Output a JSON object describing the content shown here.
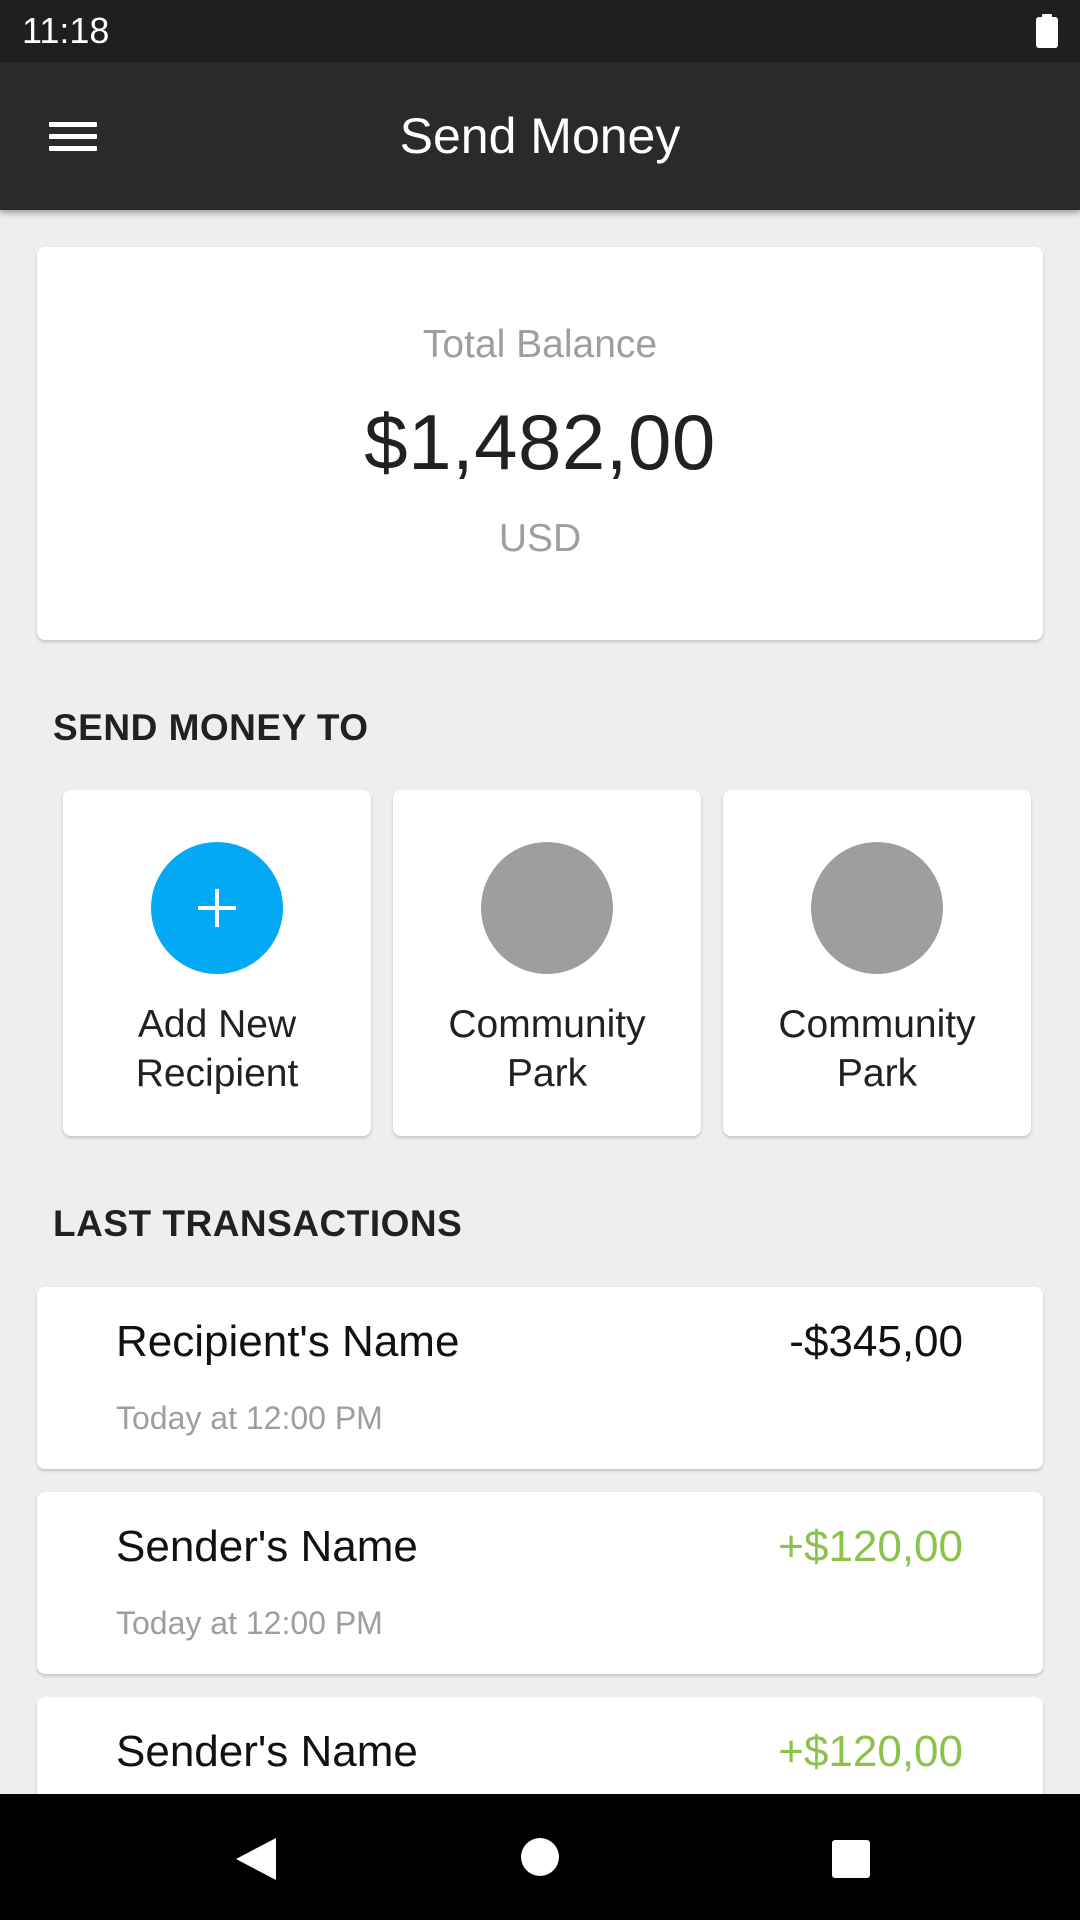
{
  "status_bar": {
    "time": "11:18",
    "battery_icon": "battery-full-icon"
  },
  "app_bar": {
    "title": "Send Money",
    "menu_icon": "menu-icon"
  },
  "balance": {
    "label": "Total Balance",
    "amount": "$1,482,00",
    "currency": "USD"
  },
  "send_money": {
    "title": "SEND MONEY TO",
    "recipients": [
      {
        "name": "Add New Recipient",
        "icon": "plus-icon",
        "color": "#03a9f4"
      },
      {
        "name": "Community Park",
        "color": "#9e9e9e"
      },
      {
        "name": "Community Park",
        "color": "#9e9e9e"
      }
    ]
  },
  "transactions": {
    "title": "LAST TRANSACTIONS",
    "items": [
      {
        "name": "Recipient's Name",
        "amount": "-$345,00",
        "time": "Today at 12:00 PM",
        "amount_color": "#111111"
      },
      {
        "name": "Sender's Name",
        "amount": "+$120,00",
        "time": "Today at 12:00 PM",
        "amount_color": "#8bc34a"
      },
      {
        "name": "Sender's Name",
        "amount": "+$120,00",
        "time": "",
        "amount_color": "#8bc34a"
      }
    ]
  },
  "nav_bar": {
    "back_icon": "back-icon",
    "home_icon": "home-icon",
    "recents_icon": "recents-icon"
  }
}
